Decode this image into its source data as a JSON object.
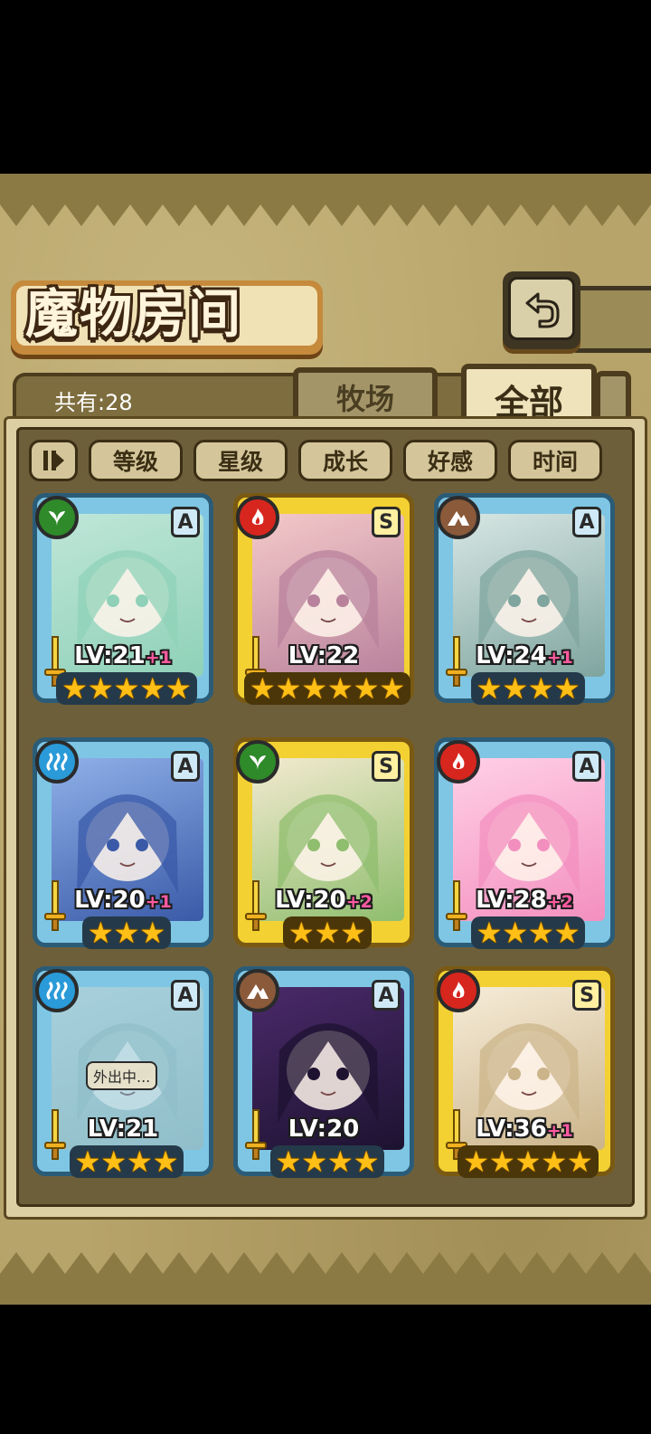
{
  "header": {
    "title": "魔物房间"
  },
  "summary": {
    "count_label": "共有:28"
  },
  "tabs": [
    {
      "label": "牧场",
      "active": false
    },
    {
      "label": "全部",
      "active": true
    }
  ],
  "sort": {
    "toggle_icon": "sort-order-icon",
    "buttons": [
      "等级",
      "星级",
      "成长",
      "好感",
      "时间"
    ]
  },
  "colors": {
    "nature": "#2f8a2a",
    "fire": "#d7261e",
    "water": "#2a9ad8",
    "earth": "#8a5a3a",
    "blue_frame": "#7fc6e4",
    "gold_frame": "#f3d132",
    "bonus": "#ff5aa0"
  },
  "monsters": [
    {
      "element": "nature-icon",
      "rank": "A",
      "level": "LV:21",
      "bonus": "+1",
      "stars": 5,
      "frame": "blue",
      "status": ""
    },
    {
      "element": "fire-icon",
      "rank": "S",
      "level": "LV:22",
      "bonus": "",
      "stars": 6,
      "frame": "gold",
      "status": ""
    },
    {
      "element": "earth-icon",
      "rank": "A",
      "level": "LV:24",
      "bonus": "+1",
      "stars": 4,
      "frame": "blue",
      "status": ""
    },
    {
      "element": "water-icon",
      "rank": "A",
      "level": "LV:20",
      "bonus": "+1",
      "stars": 3,
      "frame": "blue",
      "status": ""
    },
    {
      "element": "nature-icon",
      "rank": "S",
      "level": "LV:20",
      "bonus": "+2",
      "stars": 3,
      "frame": "gold",
      "status": ""
    },
    {
      "element": "fire-icon",
      "rank": "A",
      "level": "LV:28",
      "bonus": "+2",
      "stars": 4,
      "frame": "blue",
      "status": ""
    },
    {
      "element": "water-icon",
      "rank": "A",
      "level": "LV:21",
      "bonus": "",
      "stars": 4,
      "frame": "blue",
      "status": "外出中..."
    },
    {
      "element": "earth-icon",
      "rank": "A",
      "level": "LV:20",
      "bonus": "",
      "stars": 4,
      "frame": "blue",
      "status": ""
    },
    {
      "element": "fire-icon",
      "rank": "S",
      "level": "LV:36",
      "bonus": "+1",
      "stars": 5,
      "frame": "gold",
      "status": ""
    }
  ]
}
